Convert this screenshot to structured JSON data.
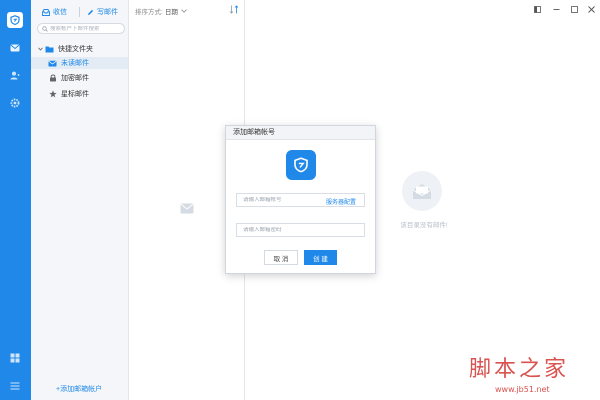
{
  "toolbar": {
    "inbox_label": "收信",
    "write_label": "写邮件"
  },
  "search": {
    "placeholder": "搜索帐户下邮件搜索"
  },
  "folders": {
    "quick_label": "快捷文件夹",
    "items": [
      {
        "label": "未读邮件",
        "icon": "unread-mail-icon",
        "selected": true
      },
      {
        "label": "加密邮件",
        "icon": "lock-icon",
        "selected": false
      },
      {
        "label": "星标邮件",
        "icon": "star-icon",
        "selected": false
      }
    ]
  },
  "add_account_label": "+添加邮箱帐户",
  "sort": {
    "label": "排序方式:",
    "value": "日期"
  },
  "reader": {
    "empty_text": "该目录没有邮件!"
  },
  "dialog": {
    "title": "添加邮箱帐号",
    "account_placeholder": "请输入邮箱帐号",
    "server_config_label": "服务器配置",
    "password_placeholder": "请输入邮箱密码",
    "cancel_label": "取 消",
    "create_label": "创 建"
  },
  "watermark": {
    "main": "脚本之家",
    "sub": "www.jb51.net"
  },
  "colors": {
    "accent": "#1f88e8",
    "rail": "#1f88e8",
    "watermark": "#d9534f"
  }
}
